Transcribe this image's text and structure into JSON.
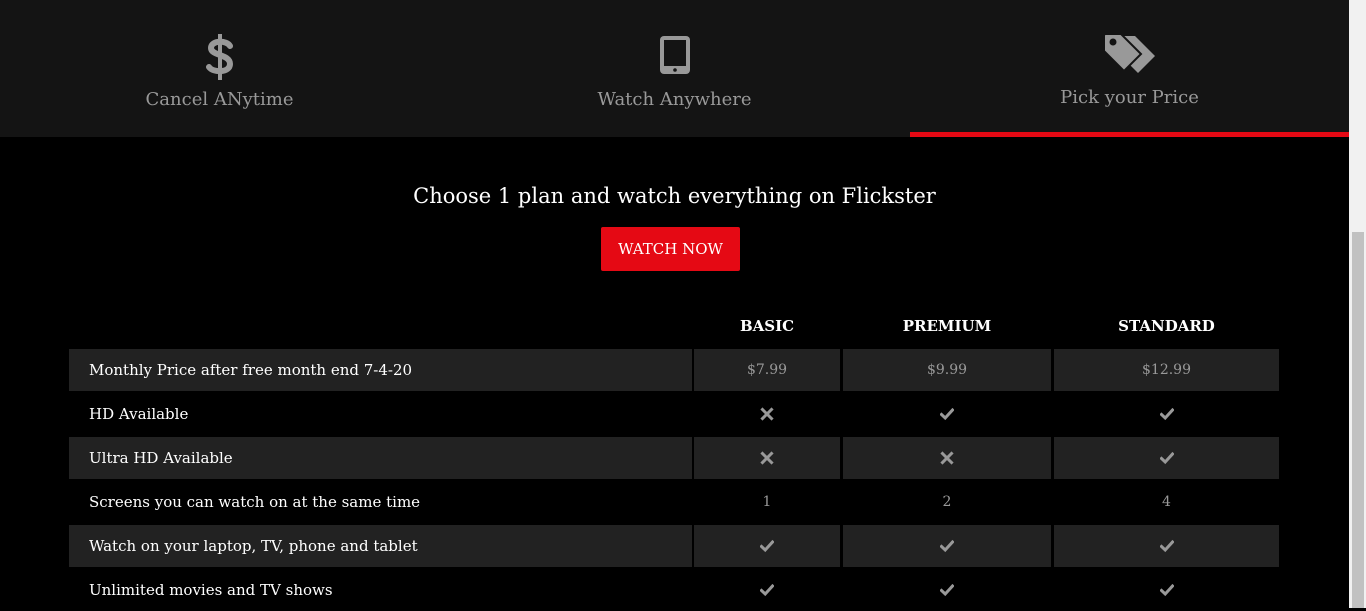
{
  "tabs": [
    {
      "label": "Cancel ANytime",
      "icon": "dollar-icon",
      "active": false
    },
    {
      "label": "Watch Anywhere",
      "icon": "tablet-icon",
      "active": false
    },
    {
      "label": "Pick your Price",
      "icon": "tags-icon",
      "active": true
    }
  ],
  "colors": {
    "accent": "#e50914",
    "bar": "#141414",
    "shaded_row": "#222222",
    "muted": "#999999"
  },
  "promo": {
    "headline": "Choose 1 plan and watch everything on Flickster",
    "cta_label": "WATCH NOW"
  },
  "plans": [
    "BASIC",
    "PREMIUM",
    "STANDARD"
  ],
  "rows": [
    {
      "label": "Monthly Price after free month end 7-4-20",
      "values": [
        "$7.99",
        "$9.99",
        "$12.99"
      ]
    },
    {
      "label": "HD Available",
      "values": [
        "cross-icon",
        "check-icon",
        "check-icon"
      ]
    },
    {
      "label": "Ultra HD Available",
      "values": [
        "cross-icon",
        "cross-icon",
        "check-icon"
      ]
    },
    {
      "label": "Screens you can watch on at the same time",
      "values": [
        "1",
        "2",
        "4"
      ]
    },
    {
      "label": "Watch on your laptop, TV, phone and tablet",
      "values": [
        "check-icon",
        "check-icon",
        "check-icon"
      ]
    },
    {
      "label": "Unlimited movies and TV shows",
      "values": [
        "check-icon",
        "check-icon",
        "check-icon"
      ]
    }
  ]
}
